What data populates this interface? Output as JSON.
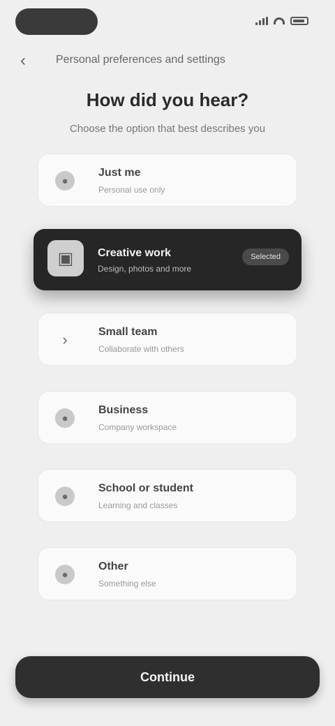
{
  "status_bar": {
    "time": ""
  },
  "nav": {
    "back_icon": "chevron-left-icon",
    "title": "Personal preferences and settings"
  },
  "heading": "How did you hear?",
  "subheading": "Choose the option that best describes you",
  "options": [
    {
      "icon": "person-icon",
      "glyph": "●",
      "title": "Just me",
      "desc": "Personal use only",
      "selected": false
    },
    {
      "icon": "image-icon",
      "glyph": "▣",
      "title": "Creative work",
      "desc": "Design, photos and more",
      "badge": "Selected",
      "selected": true
    },
    {
      "icon": "chevron-right-icon",
      "glyph": "›",
      "title": "Small team",
      "desc": "Collaborate with others",
      "selected": false
    },
    {
      "icon": "building-icon",
      "glyph": "●",
      "title": "Business",
      "desc": "Company workspace",
      "selected": false
    },
    {
      "icon": "school-icon",
      "glyph": "●",
      "title": "School or student",
      "desc": "Learning and classes",
      "selected": false
    },
    {
      "icon": "dots-icon",
      "glyph": "●",
      "title": "Other",
      "desc": "Something else",
      "selected": false
    }
  ],
  "primary_button": {
    "label": "Continue"
  },
  "colors": {
    "accent": "#262626",
    "background": "#efefef",
    "card": "#fafafa"
  }
}
